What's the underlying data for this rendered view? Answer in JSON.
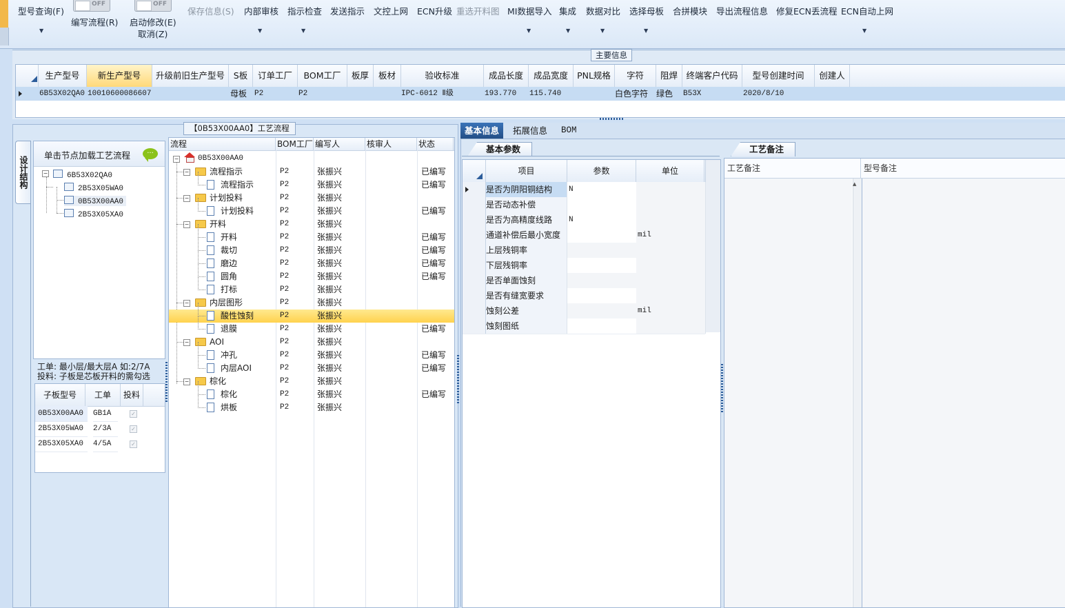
{
  "toolbar": {
    "model_query": "型号查询(F)",
    "write_flow": "编写流程(R)",
    "start_modify": "启动修改(E)",
    "cancel": "取消(Z)",
    "save_info": "保存信息(S)",
    "internal_review": "内部审核",
    "instruction_check": "指示检查",
    "send_instruction": "发送指示",
    "doc_online": "文控上网",
    "ecn_upgrade": "ECN升级",
    "reselect_cutting": "重选开料图",
    "mi_import": "MI数据导入",
    "integrate": "集成",
    "data_compare": "数据对比",
    "select_mother": "选择母板",
    "merge_module": "合拼模块",
    "export_flow": "导出流程信息",
    "fix_ecn_flow": "修复ECN丢流程",
    "ecn_auto_online": "ECN自动上网",
    "toggle_off": "OFF"
  },
  "main_info": {
    "caption": "主要信息",
    "columns": [
      "生产型号",
      "新生产型号",
      "升级前旧生产型号",
      "S板",
      "订单工厂",
      "BOM工厂",
      "板厚",
      "板材",
      "验收标准",
      "成品长度",
      "成品宽度",
      "PNL规格",
      "字符",
      "阻焊",
      "终端客户代码",
      "型号创建时间",
      "创建人"
    ],
    "row": {
      "prod_model": "6B53X02QA0",
      "new_model": "10010600086607",
      "s_board": "母板",
      "order_factory": "P2",
      "bom_factory": "P2",
      "standard": "IPC-6012 Ⅱ级",
      "length": "193.770",
      "width": "115.740",
      "char": "白色字符",
      "solder": "绿色",
      "customer": "B53X",
      "created": "2020/8/10"
    }
  },
  "left": {
    "vtab": "设计结构",
    "flow_caption": "【0B53X00AA0】工艺流程",
    "tree_header": "单击节点加载工艺流程",
    "tree_nodes": [
      "6B53X02QA0",
      "2B53X05WA0",
      "0B53X00AA0",
      "2B53X05XA0"
    ],
    "info_line1": "工单: 最小层/最大层A 如:2/7A",
    "info_line2": "投料: 子板是芯板开料的需勾选",
    "sub_columns": [
      "子板型号",
      "工单",
      "投料"
    ],
    "sub_rows": [
      {
        "model": "0B53X00AA0",
        "order": "GB1A"
      },
      {
        "model": "2B53X05WA0",
        "order": "2/3A"
      },
      {
        "model": "2B53X05XA0",
        "order": "4/5A"
      }
    ]
  },
  "flow": {
    "columns": [
      "流程",
      "BOM工厂",
      "编写人",
      "核审人",
      "状态"
    ],
    "root": "0B53X00AA0",
    "rows": [
      {
        "name": "流程指示",
        "type": "folder",
        "factory": "P2",
        "writer": "张振兴",
        "status": "已编写"
      },
      {
        "name": "流程指示",
        "type": "doc",
        "factory": "P2",
        "writer": "张振兴",
        "status": "已编写"
      },
      {
        "name": "计划投料",
        "type": "folder",
        "factory": "P2",
        "writer": "张振兴",
        "status": ""
      },
      {
        "name": "计划投料",
        "type": "doc",
        "factory": "P2",
        "writer": "张振兴",
        "status": "已编写"
      },
      {
        "name": "开料",
        "type": "folder",
        "factory": "P2",
        "writer": "张振兴",
        "status": ""
      },
      {
        "name": "开料",
        "type": "doc",
        "factory": "P2",
        "writer": "张振兴",
        "status": "已编写"
      },
      {
        "name": "裁切",
        "type": "doc",
        "factory": "P2",
        "writer": "张振兴",
        "status": "已编写"
      },
      {
        "name": "磨边",
        "type": "doc",
        "factory": "P2",
        "writer": "张振兴",
        "status": "已编写"
      },
      {
        "name": "圆角",
        "type": "doc",
        "factory": "P2",
        "writer": "张振兴",
        "status": "已编写"
      },
      {
        "name": "打标",
        "type": "doc",
        "factory": "P2",
        "writer": "张振兴",
        "status": ""
      },
      {
        "name": "内层图形",
        "type": "folder",
        "factory": "P2",
        "writer": "张振兴",
        "status": ""
      },
      {
        "name": "酸性蚀刻",
        "type": "doc",
        "factory": "P2",
        "writer": "张振兴",
        "status": "",
        "selected": true
      },
      {
        "name": "退膜",
        "type": "doc",
        "factory": "P2",
        "writer": "张振兴",
        "status": "已编写"
      },
      {
        "name": "AOI",
        "type": "folder",
        "factory": "P2",
        "writer": "张振兴",
        "status": ""
      },
      {
        "name": "冲孔",
        "type": "doc",
        "factory": "P2",
        "writer": "张振兴",
        "status": "已编写"
      },
      {
        "name": "内层AOI",
        "type": "doc",
        "factory": "P2",
        "writer": "张振兴",
        "status": "已编写"
      },
      {
        "name": "棕化",
        "type": "folder",
        "factory": "P2",
        "writer": "张振兴",
        "status": ""
      },
      {
        "name": "棕化",
        "type": "doc",
        "factory": "P2",
        "writer": "张振兴",
        "status": "已编写"
      },
      {
        "name": "烘板",
        "type": "doc",
        "factory": "P2",
        "writer": "张振兴",
        "status": ""
      }
    ]
  },
  "right": {
    "tabs": [
      "基本信息",
      "拓展信息",
      "BOM"
    ],
    "basic_params_tab": "基本参数",
    "process_remark_tab": "工艺备注",
    "param_columns": [
      "项目",
      "参数",
      "单位"
    ],
    "params": [
      {
        "item": "是否为阴阳铜结构",
        "value": "N",
        "unit": ""
      },
      {
        "item": "是否动态补偿",
        "value": "",
        "unit": ""
      },
      {
        "item": "是否为高精度线路",
        "value": "N",
        "unit": ""
      },
      {
        "item": "通道补偿后最小宽度",
        "value": "",
        "unit": "mil"
      },
      {
        "item": "上层残铜率",
        "value": "",
        "unit": ""
      },
      {
        "item": "下层残铜率",
        "value": "",
        "unit": ""
      },
      {
        "item": "是否单面蚀刻",
        "value": "",
        "unit": ""
      },
      {
        "item": "是否有缝宽要求",
        "value": "",
        "unit": ""
      },
      {
        "item": "蚀刻公差",
        "value": "",
        "unit": "mil"
      },
      {
        "item": "蚀刻图纸",
        "value": "",
        "unit": ""
      }
    ],
    "remark_process": "工艺备注",
    "remark_model": "型号备注"
  }
}
